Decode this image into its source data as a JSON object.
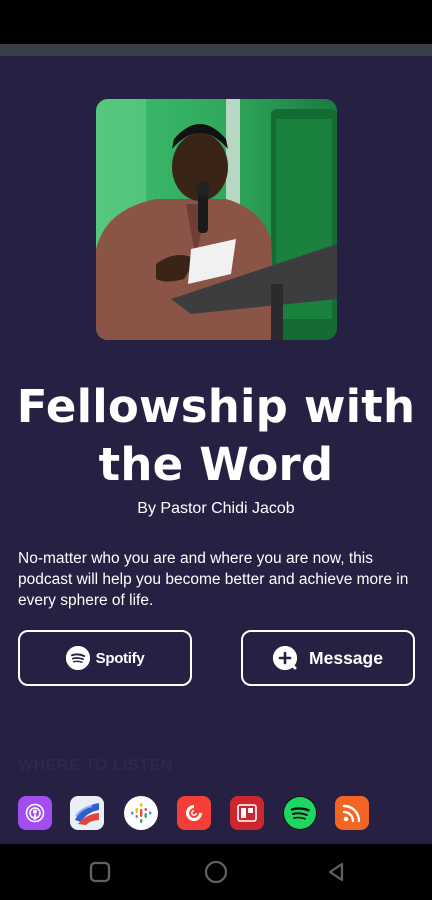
{
  "podcast": {
    "title": "Fellowship with the Word",
    "author": "By Pastor Chidi Jacob",
    "description": "No-matter who you are and where you are now, this podcast will help you become better and achieve more in every sphere of life.",
    "cover_image": "pastor-speaking-at-podium-photo"
  },
  "buttons": {
    "spotify_label": "Spotify",
    "message_label": "Message"
  },
  "where_to_listen": {
    "heading": "WHERE TO LISTEN",
    "platforms": [
      {
        "name": "apple-podcasts",
        "color": "#a24cf2"
      },
      {
        "name": "castbox-wave",
        "color": "#2f5fcf"
      },
      {
        "name": "google-podcasts",
        "color": "#ffffff"
      },
      {
        "name": "pocket-casts",
        "color": "#f43e37"
      },
      {
        "name": "radiopublic",
        "color": "#ce262f"
      },
      {
        "name": "spotify",
        "color": "#1ed760"
      },
      {
        "name": "rss-feed",
        "color": "#f26522"
      }
    ]
  },
  "colors": {
    "background": "#262043",
    "text": "#ffffff",
    "button_border": "#ffffff"
  },
  "navigation": {
    "buttons": [
      "recent-apps",
      "home",
      "back"
    ]
  }
}
